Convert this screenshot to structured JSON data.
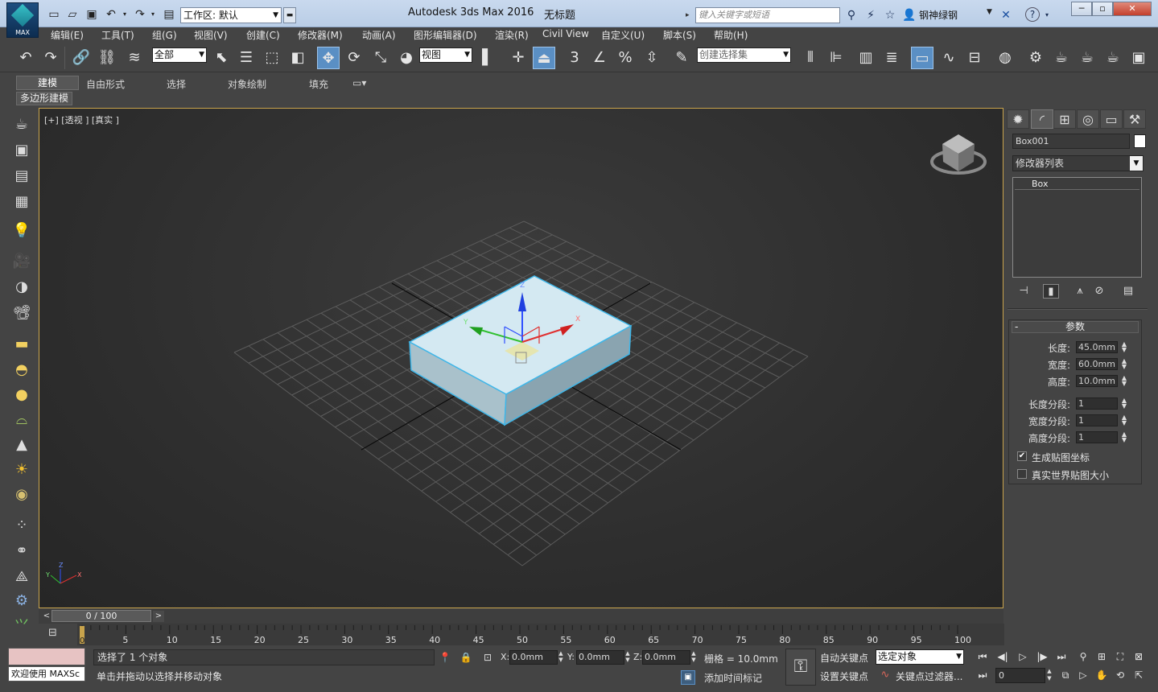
{
  "title_bar": {
    "logo_text": "MAX",
    "workspace_label": "工作区: 默认",
    "app_title": "Autodesk 3ds Max 2016",
    "doc_title": "无标题",
    "search_placeholder": "键入关键字或短语",
    "user_name": "钢神绿钢"
  },
  "menu": [
    "编辑(E)",
    "工具(T)",
    "组(G)",
    "视图(V)",
    "创建(C)",
    "修改器(M)",
    "动画(A)",
    "图形编辑器(D)",
    "渲染(R)",
    "Civil View",
    "自定义(U)",
    "脚本(S)",
    "帮助(H)"
  ],
  "toolbar": {
    "filter_value": "全部",
    "ref_coord_value": "视图",
    "named_sel_value": "创建选择集",
    "snap_label": "3",
    "angle_snap_label": "%"
  },
  "ribbon": {
    "tabs": [
      "建模",
      "自由形式",
      "选择",
      "对象绘制",
      "填充"
    ],
    "panel_label": "多边形建模"
  },
  "viewport": {
    "label": "[+] [透视 ] [真实 ]",
    "gizmo_axes": [
      "Z",
      "X",
      "Y"
    ]
  },
  "command_panel": {
    "object_name": "Box001",
    "object_color": "#ffffff",
    "modifier_list_label": "修改器列表",
    "stack_item": "Box",
    "rollout_title": "参数",
    "rollout_toggle": "-",
    "params": [
      {
        "label": "长度:",
        "value": "45.0mm"
      },
      {
        "label": "宽度:",
        "value": "60.0mm"
      },
      {
        "label": "高度:",
        "value": "10.0mm"
      },
      {
        "label": "长度分段:",
        "value": "1"
      },
      {
        "label": "宽度分段:",
        "value": "1"
      },
      {
        "label": "高度分段:",
        "value": "1"
      }
    ],
    "checkboxes": [
      {
        "label": "生成贴图坐标",
        "checked": true
      },
      {
        "label": "真实世界贴图大小",
        "checked": false
      }
    ]
  },
  "time_slider": {
    "position_label": "0 / 100",
    "ticks": [
      "0",
      "5",
      "10",
      "15",
      "20",
      "25",
      "30",
      "35",
      "40",
      "45",
      "50",
      "55",
      "60",
      "65",
      "70",
      "75",
      "80",
      "85",
      "90",
      "95",
      "100"
    ]
  },
  "status": {
    "welcome": "欢迎使用 MAXSc",
    "selection_text": "选择了 1 个对象",
    "prompt_text": "单击并拖动以选择并移动对象",
    "x_label": "X:",
    "x_value": "0.0mm",
    "y_label": "Y:",
    "y_value": "0.0mm",
    "z_label": "Z:",
    "z_value": "0.0mm",
    "grid_text": "栅格 = 10.0mm",
    "time_tag_text": "添加时间标记",
    "auto_key": "自动关键点",
    "set_key": "设置关键点",
    "selected_dd": "选定对象",
    "key_filters": "关键点过滤器...",
    "frame_value": "0"
  },
  "colors": {
    "viewport_border": "#c9a44c",
    "box_fill": "#c7e2ee",
    "selection_edge": "#3fb6e8"
  }
}
